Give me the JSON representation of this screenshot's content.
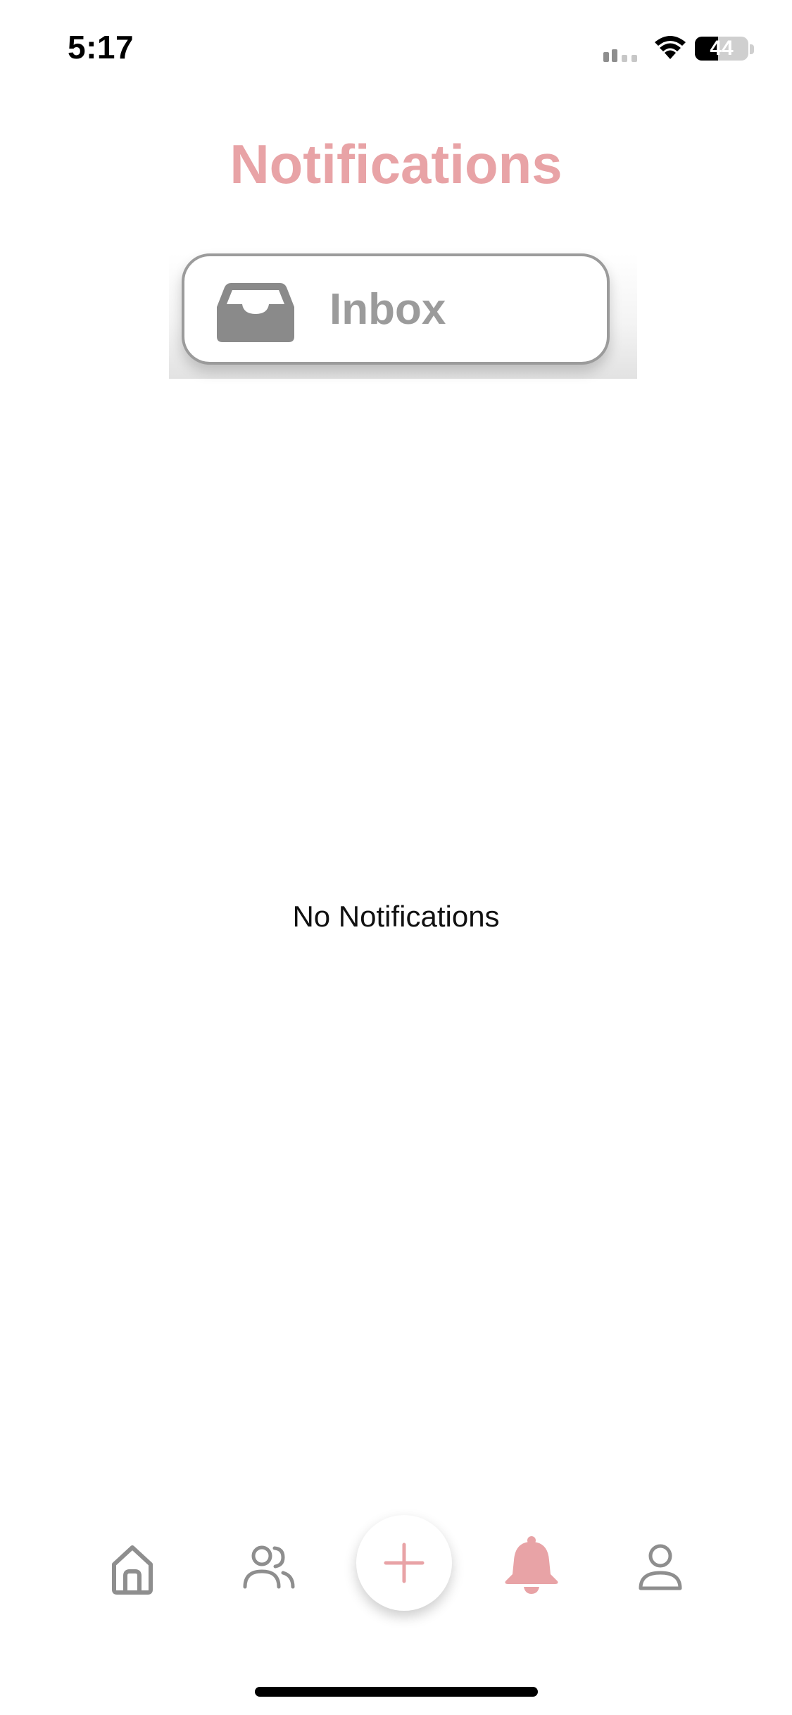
{
  "status_bar": {
    "time": "5:17",
    "battery_level": "44",
    "icons": [
      "signal-icon",
      "wifi-icon",
      "battery-icon"
    ]
  },
  "header": {
    "title": "Notifications"
  },
  "tabs": [
    {
      "label": "Inbox",
      "icon": "inbox-tray-icon",
      "selected": true
    }
  ],
  "empty_state": {
    "message": "No Notifications"
  },
  "bottom_nav": {
    "items": [
      {
        "name": "home",
        "icon": "home-icon",
        "active": false
      },
      {
        "name": "friends",
        "icon": "people-icon",
        "active": false
      },
      {
        "name": "create",
        "icon": "plus-icon",
        "active": false
      },
      {
        "name": "notifications",
        "icon": "bell-icon",
        "active": true
      },
      {
        "name": "profile",
        "icon": "person-icon",
        "active": false
      }
    ]
  },
  "colors": {
    "accent": "#e8a3a6",
    "inactive_icon": "#8e8e8e",
    "tab_border": "#9b9b9b",
    "text": "#111111"
  }
}
